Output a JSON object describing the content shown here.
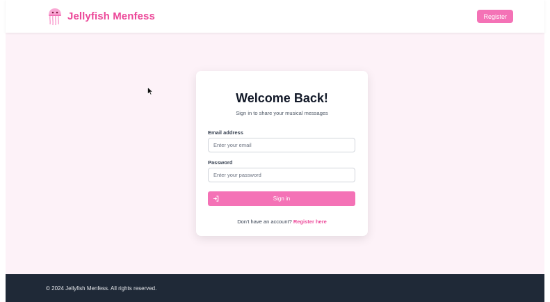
{
  "header": {
    "brand_name": "Jellyfish Menfess",
    "register_label": "Register",
    "logo_icon": "jellyfish-icon"
  },
  "login": {
    "title": "Welcome Back!",
    "subtitle": "Sign in to share your musical messages",
    "email_label": "Email address",
    "email_placeholder": "Enter your email",
    "password_label": "Password",
    "password_placeholder": "Enter your password",
    "signin_label": "Sign in",
    "signin_icon": "sign-in-icon",
    "no_account_text": "Don't have an account?",
    "register_link": "Register here"
  },
  "footer": {
    "copyright": "© 2024 Jellyfish Menfess. All rights reserved."
  },
  "colors": {
    "accent": "#ec4899",
    "button": "#f472b6",
    "page_background": "#fdf2f8",
    "footer_background": "#1f2937"
  }
}
